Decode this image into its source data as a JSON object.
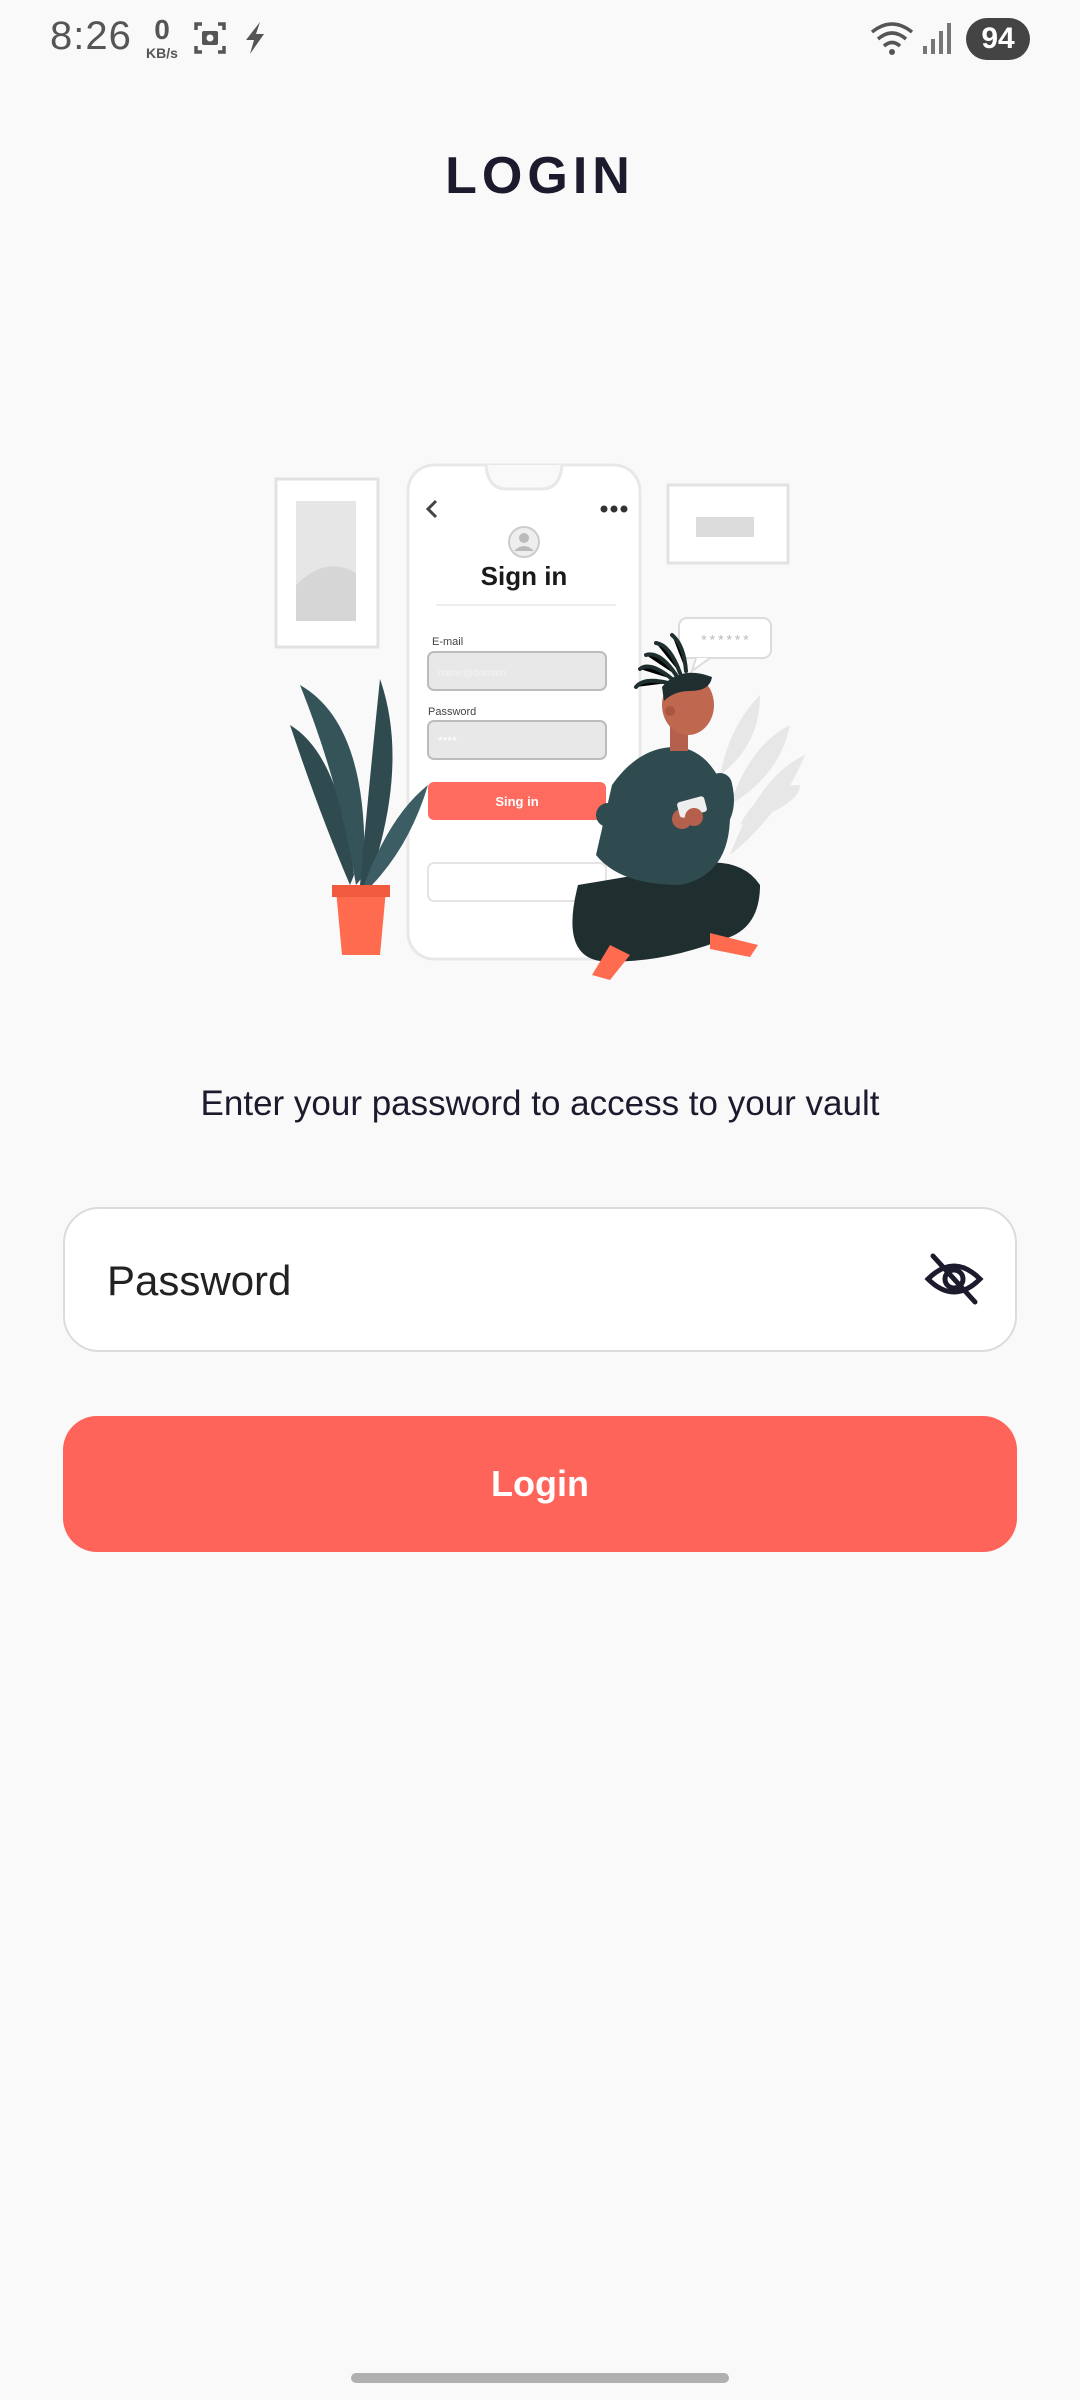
{
  "status_bar": {
    "time": "8:26",
    "net_speed_value": "0",
    "net_speed_unit": "KB/s",
    "battery_level": "94",
    "icons": [
      "screenshot-icon",
      "flash-icon",
      "wifi-icon",
      "signal-icon",
      "battery-icon"
    ]
  },
  "header": {
    "title": "LOGIN"
  },
  "illustration": {
    "heading": "Sign in",
    "email_label": "E-mail",
    "password_label": "Password",
    "button_label": "Sing in",
    "speech_bubble": "******",
    "password_dots": "****",
    "email_placeholder": "name@domain"
  },
  "main": {
    "subtitle": "Enter your password to access to your vault",
    "password_placeholder": "Password",
    "login_label": "Login"
  },
  "colors": {
    "accent": "#ff645a",
    "background": "#f9f9f9",
    "text": "#1c1b2e",
    "plant": "#2f4b50"
  }
}
